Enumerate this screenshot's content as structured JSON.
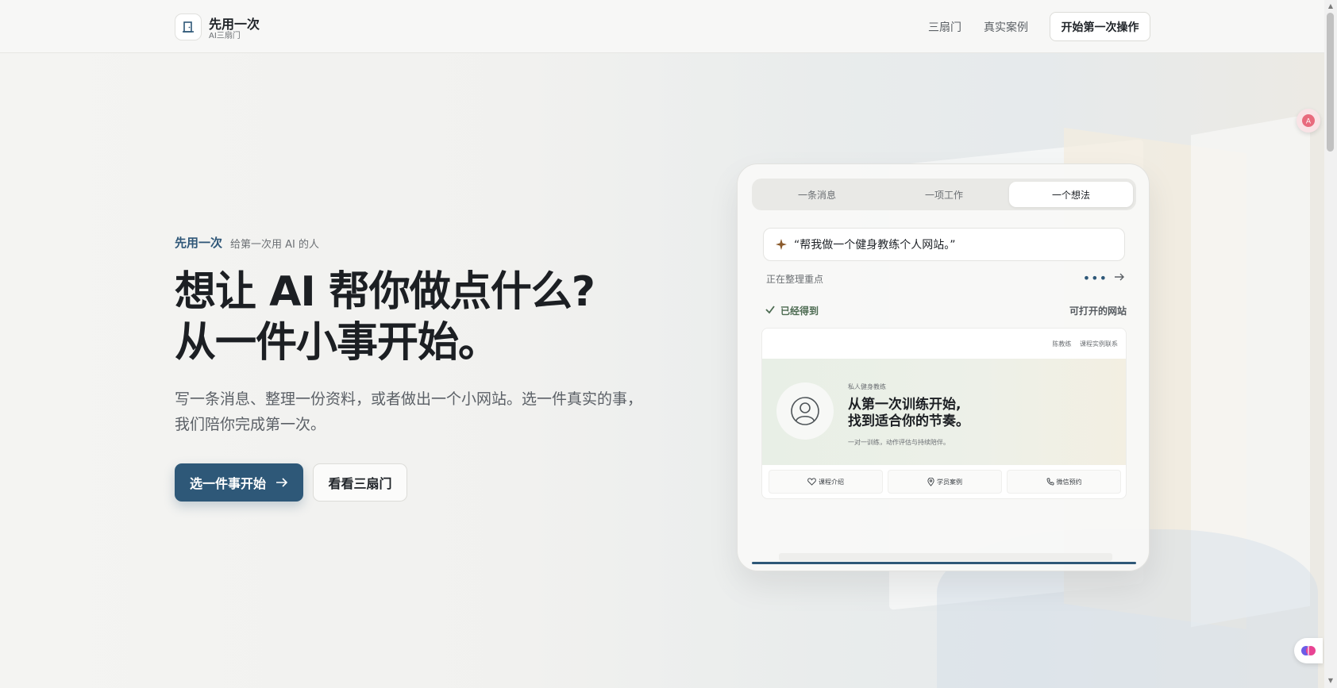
{
  "header": {
    "brand_name": "先用一次",
    "brand_sub": "AI三扇门",
    "nav": [
      "三扇门",
      "真实案例"
    ],
    "cta": "开始第一次操作"
  },
  "hero": {
    "eyebrow_brand": "先用一次",
    "eyebrow_text": "给第一次用 AI 的人",
    "title_line1": "想让 AI 帮你做点什么?",
    "title_line2": "从一件小事开始。",
    "desc_line1": "写一条消息、整理一份资料，或者做出一个小网站。选一件真实的事，",
    "desc_line2": "我们陪你完成第一次。",
    "primary_button": "选一件事开始",
    "secondary_button": "看看三扇门"
  },
  "demo": {
    "tabs": [
      "一条消息",
      "一项工作",
      "一个想法"
    ],
    "active_tab": 2,
    "prompt": "“帮我做一个健身教练个人网站。”",
    "status": "正在整理重点",
    "result_label": "已经得到",
    "result_type": "可打开的网站",
    "preview": {
      "nav": [
        "陈教练",
        "课程实例联系"
      ],
      "kicker": "私人健身教练",
      "title_line1": "从第一次训练开始,",
      "title_line2": "找到适合你的节奏。",
      "desc": "一对一训练，动作评估与持续陪伴。",
      "links": [
        {
          "label": "课程介绍",
          "icon": "heart-icon"
        },
        {
          "label": "学员案例",
          "icon": "map-pin-icon"
        },
        {
          "label": "微信预约",
          "icon": "phone-icon"
        }
      ]
    }
  },
  "colors": {
    "accent": "#2e5878",
    "text": "#1c1f23",
    "muted": "#6b6f73",
    "success": "#4d6b52"
  }
}
